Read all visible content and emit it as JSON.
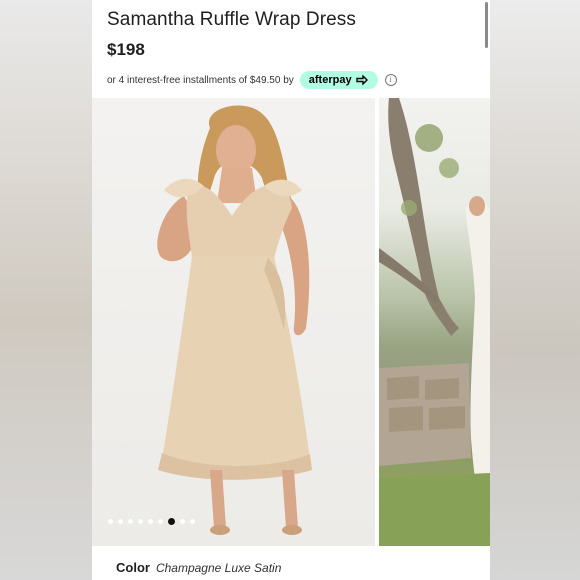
{
  "product": {
    "title": "Samantha Ruffle Wrap Dress",
    "price": "$198"
  },
  "installments": {
    "text": "or 4 interest-free installments of $49.50 by",
    "provider": "afterpay",
    "provider_icon": "afterpay-arrows-icon",
    "info_icon": "info-icon",
    "badge_color": "#b2fce4"
  },
  "gallery": {
    "image_count": 9,
    "active_index": 6
  },
  "color": {
    "label": "Color",
    "value": "Champagne Luxe Satin"
  }
}
